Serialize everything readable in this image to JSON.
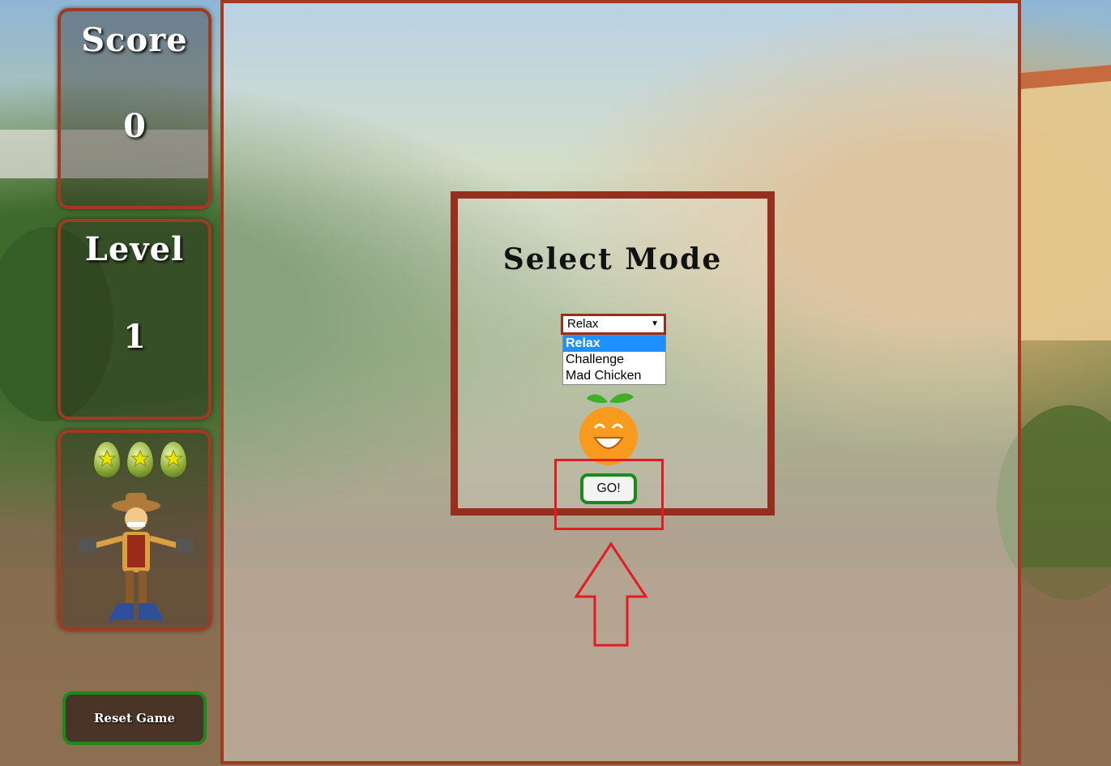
{
  "score": {
    "title": "Score",
    "value": "0"
  },
  "level": {
    "title": "Level",
    "value": "1"
  },
  "lives": {
    "count": 3,
    "icon": "star-egg-icon",
    "character": "cowboy-character"
  },
  "reset_button": {
    "label": "Reset Game"
  },
  "mode_modal": {
    "title": "Select Mode",
    "selected": "Relax",
    "options": [
      "Relax",
      "Challenge",
      "Mad Chicken"
    ],
    "go_label": "GO!"
  },
  "colors": {
    "panel_border": "#a23a22",
    "modal_border": "#962f1e",
    "go_border": "#1a8a1a",
    "highlight": "#e51b24",
    "option_selected": "#1e90ff"
  }
}
